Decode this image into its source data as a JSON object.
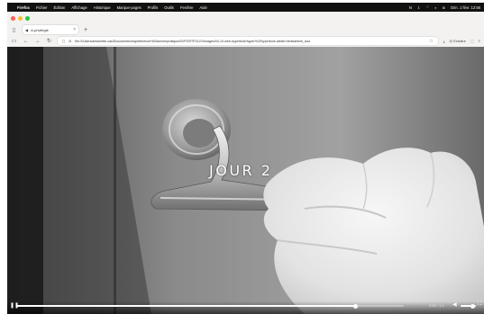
{
  "menubar": {
    "apple_icon": "apple-icon",
    "items": [
      "Firefox",
      "Fichier",
      "Édition",
      "Affichage",
      "Historique",
      "Marque-pages",
      "Profils",
      "Outils",
      "Fenêtre",
      "Aide"
    ],
    "clock": "Dim. 1 févr. 12:56"
  },
  "browser": {
    "tab": {
      "title": "A-privilégié",
      "close_icon": "close-icon"
    },
    "new_tab_label": "+",
    "url": "file:///Users/antoinette.cas/Documents/mapreference%20annee/pratique/02/PORTFOLIO/Images/04-10-web-hyperbole/hyper%20hyperbole-atelier.html#article_loca",
    "downloads_label": "Extraire",
    "bookmark_icon": "star-icon"
  },
  "video": {
    "overlay_text": "JOUR 2",
    "progress": 0.876,
    "time_label": "0:53 / 1:1",
    "volume": 1.0
  },
  "colors": {
    "menubar_bg": "#111111",
    "chrome_bg": "#f3f2f0",
    "light_red": "#ff5f57",
    "light_yellow": "#febc2e",
    "light_green": "#28c840"
  }
}
